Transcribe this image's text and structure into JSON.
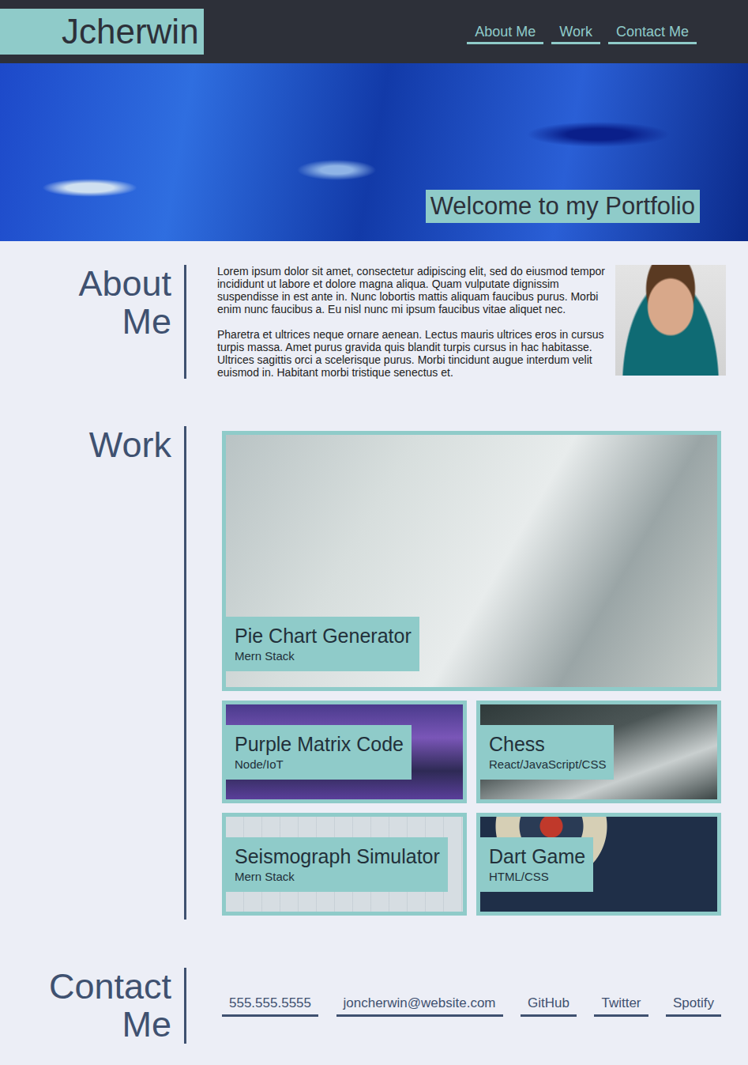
{
  "header": {
    "logo": "Jcherwin",
    "nav": [
      "About Me",
      "Work",
      "Contact Me"
    ]
  },
  "hero": {
    "title": "Welcome to my Portfolio"
  },
  "about": {
    "heading": "About Me",
    "paragraphs": [
      "Lorem ipsum dolor sit amet, consectetur adipiscing elit, sed do eiusmod tempor incididunt ut labore et dolore magna aliqua. Quam vulputate dignissim suspendisse in est ante in. Nunc lobortis mattis aliquam faucibus purus. Morbi enim nunc faucibus a. Eu nisl nunc mi ipsum faucibus vitae aliquet nec.",
      "Pharetra et ultrices neque ornare aenean. Lectus mauris ultrices eros in cursus turpis massa. Amet purus gravida quis blandit turpis cursus in hac habitasse. Ultrices sagittis orci a scelerisque purus. Morbi tincidunt augue interdum velit euismod in. Habitant morbi tristique senectus et."
    ]
  },
  "work": {
    "heading": "Work",
    "projects": [
      {
        "title": "Pie Chart Generator",
        "stack": "Mern Stack",
        "kind": "featured"
      },
      {
        "title": "Purple Matrix Code",
        "stack": "Node/IoT",
        "kind": "tile"
      },
      {
        "title": "Chess",
        "stack": "React/JavaScript/CSS",
        "kind": "tile"
      },
      {
        "title": "Seismograph Simulator",
        "stack": "Mern Stack",
        "kind": "tile"
      },
      {
        "title": "Dart Game",
        "stack": "HTML/CSS",
        "kind": "tile"
      }
    ]
  },
  "contact": {
    "heading": "Contact Me",
    "links": [
      "555.555.5555",
      "joncherwin@website.com",
      "GitHub",
      "Twitter",
      "Spotify"
    ]
  }
}
